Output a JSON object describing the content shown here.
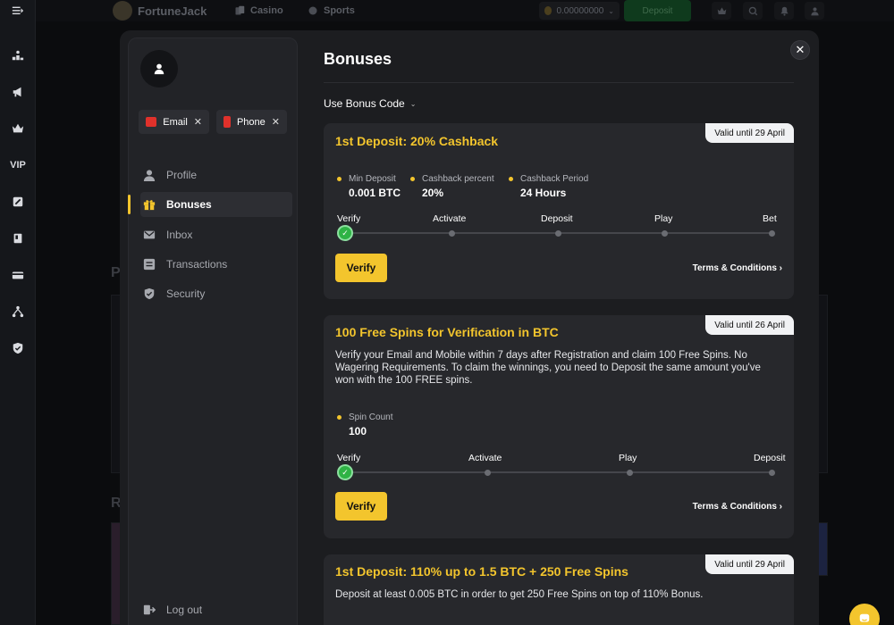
{
  "topbar": {
    "brand": "FortuneJack",
    "nav": [
      "Casino",
      "Sports"
    ],
    "balance": "0.00000000",
    "deposit_label": "Deposit"
  },
  "rail": {
    "vip_label": "VIP"
  },
  "background": {
    "letter_p": "P",
    "letter_r": "R"
  },
  "sidebar": {
    "verification_chips": [
      {
        "label": "Email",
        "status": "✕"
      },
      {
        "label": "Phone",
        "status": "✕"
      }
    ],
    "items": [
      {
        "label": "Profile",
        "icon": "user-icon"
      },
      {
        "label": "Bonuses",
        "icon": "gift-icon",
        "active": true
      },
      {
        "label": "Inbox",
        "icon": "mail-icon"
      },
      {
        "label": "Transactions",
        "icon": "transactions-icon"
      },
      {
        "label": "Security",
        "icon": "shield-icon"
      }
    ],
    "logout_label": "Log out"
  },
  "main": {
    "title": "Bonuses",
    "close_symbol": "✕",
    "bonus_code_label": "Use Bonus Code",
    "bonus_code_chevron": "⌄",
    "cards": [
      {
        "valid": "Valid until 29 April",
        "title": "1st Deposit: 20% Cashback",
        "stats": [
          {
            "label": "Min Deposit",
            "value": "0.001 BTC"
          },
          {
            "label": "Cashback percent",
            "value": "20%"
          },
          {
            "label": "Cashback Period",
            "value": "24 Hours"
          }
        ],
        "steps": [
          "Verify",
          "Activate",
          "Deposit",
          "Play",
          "Bet"
        ],
        "verify_label": "Verify",
        "terms_label": "Terms & Conditions ›"
      },
      {
        "valid": "Valid until 26 April",
        "title": "100 Free Spins for Verification in BTC",
        "description": "Verify your Email and Mobile within 7 days after Registration and claim 100 Free Spins. No Wagering Requirements. To claim the winnings, you need to Deposit the same amount you've won with the 100 FREE spins.",
        "stats": [
          {
            "label": "Spin Count",
            "value": "100"
          }
        ],
        "steps": [
          "Verify",
          "Activate",
          "Play",
          "Deposit"
        ],
        "verify_label": "Verify",
        "terms_label": "Terms & Conditions ›"
      },
      {
        "valid": "Valid until 29 April",
        "title": "1st Deposit: 110% up to 1.5 BTC + 250 Free Spins",
        "description": "Deposit at least 0.005 BTC in order to get 250 Free Spins on top of 110% Bonus."
      }
    ]
  },
  "colors": {
    "accent": "#f3c52d",
    "success": "#2fb345",
    "alert": "#e0312b"
  }
}
